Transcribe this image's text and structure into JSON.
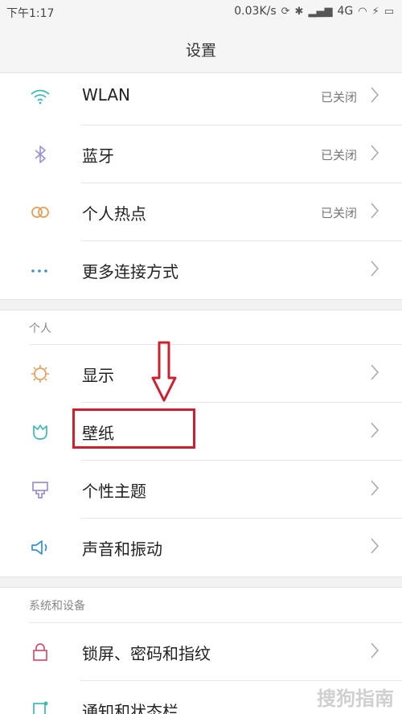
{
  "status_bar": {
    "time": "下午1:17",
    "net_speed": "0.03K/s",
    "network": "4G"
  },
  "header": {
    "title": "设置"
  },
  "wireless": [
    {
      "label": "WLAN",
      "value": "已关闭",
      "icon": "wifi-icon"
    },
    {
      "label": "蓝牙",
      "value": "已关闭",
      "icon": "bluetooth-icon"
    },
    {
      "label": "个人热点",
      "value": "已关闭",
      "icon": "hotspot-icon"
    },
    {
      "label": "更多连接方式",
      "value": "",
      "icon": "more-dots-icon"
    }
  ],
  "personal": {
    "header": "个人",
    "items": [
      {
        "label": "显示",
        "icon": "brightness-icon"
      },
      {
        "label": "壁纸",
        "icon": "wallpaper-tulip-icon"
      },
      {
        "label": "个性主题",
        "icon": "theme-brush-icon"
      },
      {
        "label": "声音和振动",
        "icon": "speaker-icon"
      }
    ]
  },
  "system": {
    "header": "系统和设备",
    "items": [
      {
        "label": "锁屏、密码和指纹",
        "icon": "lock-icon"
      },
      {
        "label": "通知和状态栏",
        "icon": "notification-icon"
      }
    ]
  },
  "watermark": "搜狗指南",
  "colors": {
    "accent_wifi": "#3fb8b0",
    "accent_bluetooth": "#9b8fd0",
    "accent_hotspot": "#e0a060",
    "highlight_red": "#cc2030"
  }
}
